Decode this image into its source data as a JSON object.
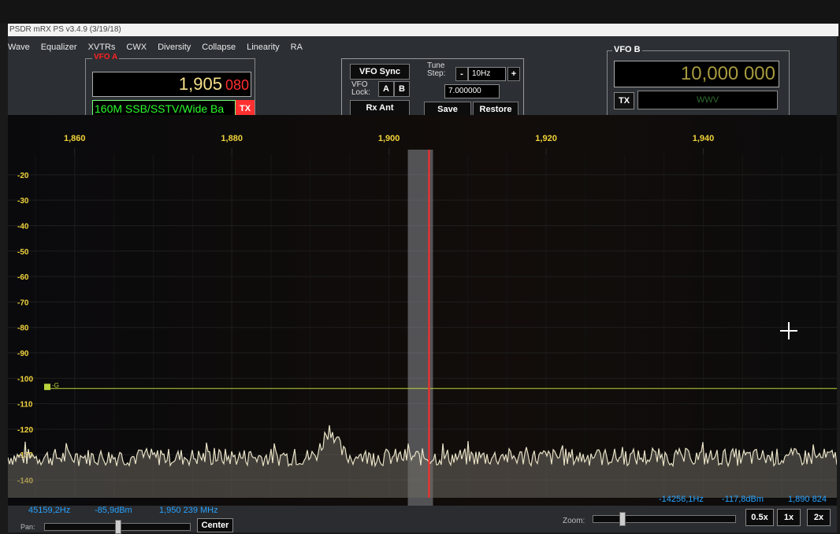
{
  "window": {
    "title": "PSDR mRX PS v3.4.9 (3/19/18)"
  },
  "menu": [
    "Wave",
    "Equalizer",
    "XVTRs",
    "CWX",
    "Diversity",
    "Collapse",
    "Linearity",
    "RA"
  ],
  "vfo_a": {
    "label": "VFO A",
    "freq_main": "1,905",
    "freq_sub": "080",
    "mode": "160M SSB/SSTV/Wide Ba",
    "tx": "TX"
  },
  "controls": {
    "vfo_sync": "VFO Sync",
    "vfo_lock_label": "VFO Lock:",
    "lock_a": "A",
    "lock_b": "B",
    "rx_ant": "Rx Ant",
    "tune_step_label": "Tune Step:",
    "step_minus": "-",
    "step_value": "10Hz",
    "step_plus": "+",
    "freq_field": "7.000000",
    "save": "Save",
    "restore": "Restore"
  },
  "vfo_b": {
    "label": "VFO B",
    "freq": "10,000 000",
    "mode": "WWV",
    "tx": "TX"
  },
  "spectrum": {
    "freq_ticks": [
      {
        "label": "1,860",
        "mhz": 1.86
      },
      {
        "label": "1,880",
        "mhz": 1.88
      },
      {
        "label": "1,900",
        "mhz": 1.9
      },
      {
        "label": "1,920",
        "mhz": 1.92
      },
      {
        "label": "1,940",
        "mhz": 1.94
      }
    ],
    "db_ticks": [
      "-20",
      "-30",
      "-40",
      "-50",
      "-60",
      "-70",
      "-80",
      "-90",
      "-100",
      "-110",
      "-120",
      "-130",
      "-140"
    ],
    "squelch_label": "-G",
    "squelch_db": -104,
    "noise_floor_db": -131,
    "bump_center_mhz": 1.8925,
    "bump_peak_db": -120,
    "passband_start_mhz": 1.9024,
    "passband_end_mhz": 1.9056,
    "vfo_marker_mhz": 1.9051,
    "colors": {
      "trace": "#e8e2c6",
      "vfo_line": "#ff2a2a",
      "squelch": "#b9d43a",
      "tick_text": "#f0d23a",
      "passband": "#8a8e95"
    }
  },
  "status": {
    "left_offset": "45159,2Hz",
    "left_dbm": "-85,9dBm",
    "left_mhz": "1,950 239 MHz",
    "right_offset": "-14256,1Hz",
    "right_dbm": "-117,8dBm",
    "right_mhz": "1,890 824"
  },
  "bottom": {
    "pan_label": "Pan:",
    "center": "Center",
    "zoom_label": "Zoom:",
    "zoom_half": "0.5x",
    "zoom_1x": "1x",
    "zoom_2x": "2x"
  }
}
